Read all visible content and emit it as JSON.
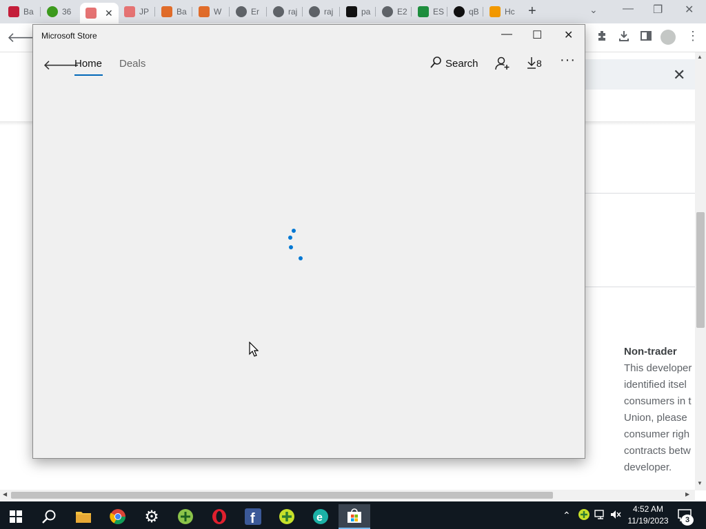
{
  "browser": {
    "tabs": [
      {
        "label": "Ba",
        "icon": "red-brand-icon",
        "color": "#c41e3a"
      },
      {
        "label": "36",
        "icon": "green-plus-icon",
        "color": "#3c9a1d"
      },
      {
        "label": "",
        "icon": "rainbow-icon",
        "color": "#e57373",
        "active": true
      },
      {
        "label": "JP",
        "icon": "rainbow-icon",
        "color": "#e57373"
      },
      {
        "label": "Ba",
        "icon": "windows-logo-icon",
        "color": "#e06c2a"
      },
      {
        "label": "W",
        "icon": "windows-logo-icon",
        "color": "#e06c2a"
      },
      {
        "label": "Er",
        "icon": "globe-icon",
        "color": "#5f6368"
      },
      {
        "label": "raj",
        "icon": "globe-icon",
        "color": "#5f6368"
      },
      {
        "label": "raj",
        "icon": "globe-icon",
        "color": "#5f6368"
      },
      {
        "label": "pa",
        "icon": "terminal-icon",
        "color": "#111111"
      },
      {
        "label": "E2",
        "icon": "globe-icon",
        "color": "#5f6368"
      },
      {
        "label": "ES",
        "icon": "star-icon",
        "color": "#1e8e3e"
      },
      {
        "label": "qB",
        "icon": "circle-icon",
        "color": "#111111"
      },
      {
        "label": "Hc",
        "icon": "bird-icon",
        "color": "#f29900"
      }
    ],
    "new_tab": "+",
    "tab_search": "⌄",
    "window_controls": {
      "minimize": "—",
      "restore": "❐",
      "close": "✕"
    },
    "tab_close": "✕",
    "back": "🡐",
    "infobar_close": "✕",
    "side_panel": {
      "title": "Non-trader",
      "lines": [
        "This developer",
        "identified itsel",
        "consumers in t",
        "Union, please",
        "consumer righ",
        "contracts betw",
        "developer."
      ]
    }
  },
  "store": {
    "window_title": "Microsoft Store",
    "controls": {
      "minimize": "—",
      "maximize": "☐",
      "close": "✕"
    },
    "back": "🡐",
    "nav": {
      "home": "Home",
      "deals": "Deals"
    },
    "search_label": "Search",
    "downloads_count": "8",
    "more": "···",
    "accent": "#0067b8"
  },
  "taskbar": {
    "apps": [
      "start",
      "search",
      "file-explorer",
      "chrome",
      "settings",
      "green-app",
      "opera",
      "facebook",
      "green-plus-app",
      "edge-e",
      "microsoft-store"
    ],
    "time": "4:52 AM",
    "date": "11/19/2023",
    "notifications": "3"
  }
}
